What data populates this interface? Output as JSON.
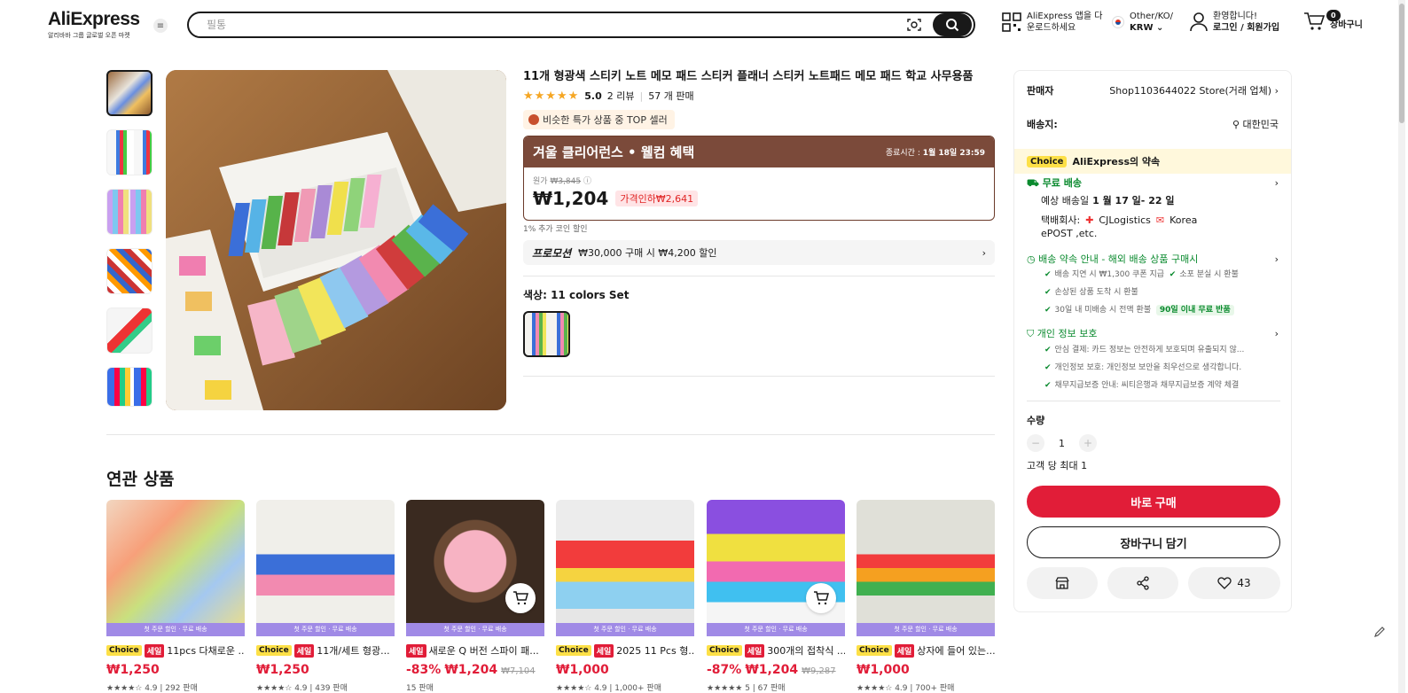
{
  "header": {
    "logo": "AliExpress",
    "logo_sub": "알리바바 그룹 글로벌 오픈 마켓",
    "search_placeholder": "필통",
    "app_line1": "AliExpress 앱을 다",
    "app_line2": "운로드하세요",
    "region_line1": "Other/KO/",
    "region_line2": "KRW",
    "account_line1": "환영합니다!",
    "account_line2": "로그인 / 회원가입",
    "cart_count": "0",
    "cart_label": "장바구니"
  },
  "product": {
    "title": "11개 형광색 스티키 노트 메모 패드 스티커 플래너 스티커 노트패드 메모 패드 학교 사무용품",
    "rating": "5.0",
    "reviews": "2 리뷰",
    "sold": "57 개 판매",
    "top_badge": "비슷한 특가 상품 중 TOP 셀러",
    "promo_title": "겨울 클리어런스 • 웰컴 혜택",
    "promo_end_label": "종료시간 :",
    "promo_end_date": "1월 18일 23:59",
    "orig_label": "원가",
    "orig_price": "₩3,845",
    "price": "₩1,204",
    "discount": "가격인하₩2,641",
    "coin": "1% 추가 코인 할인",
    "promotion_tag": "프로모션",
    "promotion_text": "₩30,000 구매 시 ₩4,200 할인",
    "color_label": "색상:",
    "color_value": "11 colors Set"
  },
  "panel": {
    "seller_label": "판매자",
    "seller_value": "Shop1103644022 Store(거래 업체)",
    "ship_to_label": "배송지:",
    "ship_to_value": "대한민국",
    "choice_tag": "Choice",
    "choice_promise": "AliExpress의 약속",
    "free_ship": "무료 배송",
    "eta_label": "예상 배송일",
    "eta_value": "1 월 17 일- 22 일",
    "courier_label": "택배회사:",
    "courier_1": "CJLogistics",
    "courier_2": "Korea",
    "courier_3": "ePOST ,etc.",
    "guide_title": "배송 약속 안내 - 해외 배송 상품 구매시",
    "guide_1a": "배송 지연 시 ₩1,300 쿠폰 지급",
    "guide_1b": "소포 분실 시 환불",
    "guide_2": "손상된 상품 도착 시 환불",
    "guide_3": "30일 내 미배송 시 전액 환불",
    "guide_3_tag": "90일 이내 무료 반품",
    "privacy_title": "개인 정보 보호",
    "privacy_1": "안심 결제: 카드 정보는 안전하게 보호되며 유출되지 않...",
    "privacy_2": "개인정보 보호: 개인정보 보안을 최우선으로 생각합니다.",
    "privacy_3": "채무지급보증 안내: 씨티은행과 채무지급보증 계약 체결",
    "qty_label": "수량",
    "qty_value": "1",
    "qty_limit": "고객 당 최대 1",
    "buy_now": "바로 구매",
    "add_cart": "장바구니 담기",
    "wish_count": "43"
  },
  "related": {
    "title": "연관 상품",
    "strip": "첫 주문 할인 · 무료 배송",
    "items": [
      {
        "tags": [
          "Choice",
          "세일"
        ],
        "name": "11pcs 다채로운 ...",
        "discount": "",
        "price": "₩1,250",
        "orig": "",
        "meta": "★★★★☆ 4.9 | 292 판매"
      },
      {
        "tags": [
          "Choice",
          "세일"
        ],
        "name": "11개/세트 형광...",
        "discount": "",
        "price": "₩1,250",
        "orig": "",
        "meta": "★★★★☆ 4.9 | 439 판매"
      },
      {
        "tags": [
          "세일"
        ],
        "name": "새로운 Q 버전 스파이 패...",
        "discount": "-83%",
        "price": "₩1,204",
        "orig": "₩7,104",
        "meta": "15 판매"
      },
      {
        "tags": [
          "Choice",
          "세일"
        ],
        "name": "2025 11 Pcs 형...",
        "discount": "",
        "price": "₩1,000",
        "orig": "",
        "meta": "★★★★☆ 4.9 | 1,000+ 판매"
      },
      {
        "tags": [
          "Choice",
          "세일"
        ],
        "name": "300개의 접착식 ...",
        "discount": "-87%",
        "price": "₩1,204",
        "orig": "₩9,287",
        "meta": "★★★★★ 5 | 67 판매"
      },
      {
        "tags": [
          "Choice",
          "세일"
        ],
        "name": "상자에 들어 있는...",
        "discount": "",
        "price": "₩1,000",
        "orig": "",
        "meta": "★★★★☆ 4.9 | 700+ 판매"
      }
    ]
  }
}
